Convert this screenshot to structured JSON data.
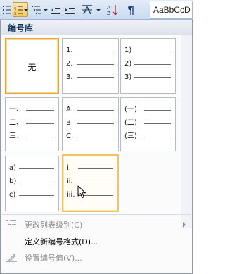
{
  "ribbon": {
    "style_preview": "AaBbCcD",
    "buttons": [
      {
        "name": "bullets-button-icon"
      },
      {
        "name": "numbering-button-icon",
        "active": true
      },
      {
        "name": "multilevel-list-button-icon"
      },
      {
        "name": "decrease-indent-icon"
      },
      {
        "name": "increase-indent-icon"
      },
      {
        "name": "chinese-layout-icon"
      },
      {
        "name": "sort-icon"
      },
      {
        "name": "show-formatting-icon"
      }
    ]
  },
  "library": {
    "title": "编号库",
    "tiles": [
      {
        "type": "none",
        "label": "无"
      },
      {
        "type": "list",
        "markers": [
          "1.",
          "2.",
          "3."
        ]
      },
      {
        "type": "list",
        "markers": [
          "1)",
          "2)",
          "3)"
        ]
      },
      {
        "type": "list",
        "markers": [
          "一、",
          "二、",
          "三、"
        ]
      },
      {
        "type": "list",
        "markers": [
          "A.",
          "B.",
          "C."
        ]
      },
      {
        "type": "list",
        "markers": [
          "(一)",
          "(二)",
          "(三)"
        ]
      },
      {
        "type": "list",
        "markers": [
          "a)",
          "b)",
          "c)"
        ]
      },
      {
        "type": "list",
        "markers": [
          "i.",
          "ii.",
          "iii."
        ]
      }
    ]
  },
  "menu": {
    "change_level": "更改列表级别(C)",
    "define_new": "定义新编号格式(D)...",
    "set_value": "设置编号值(V)..."
  }
}
